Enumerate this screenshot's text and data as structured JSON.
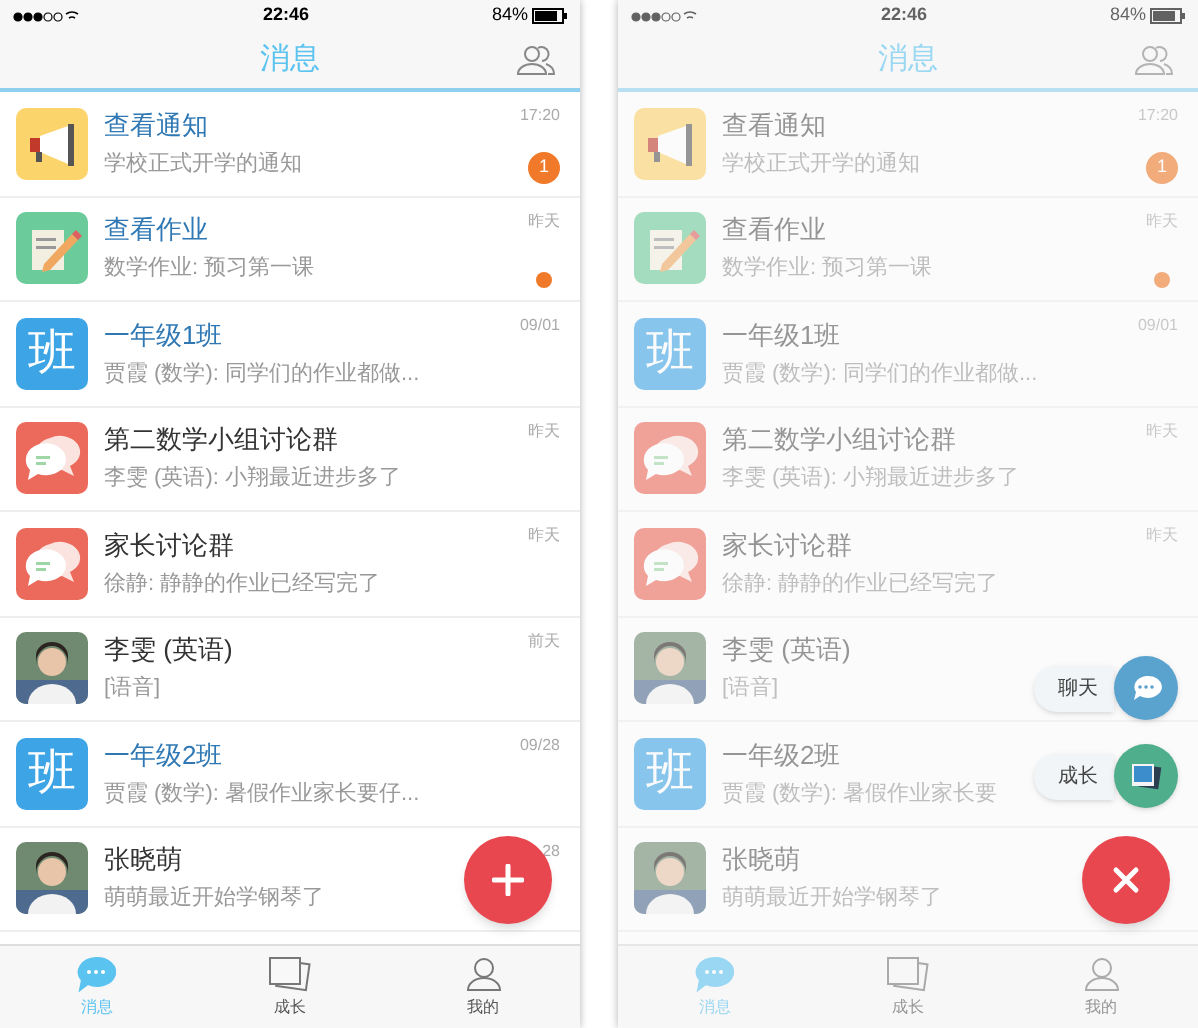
{
  "screens": [
    {
      "dimmed": false,
      "status_bar": {
        "time": "22:46",
        "battery": "84%"
      },
      "header": {
        "title": "消息"
      },
      "conversations": [
        {
          "avatar": {
            "kind": "megaphone"
          },
          "title": "查看通知",
          "color": "#2f78b4",
          "preview": "学校正式开学的通知",
          "time": "17:20",
          "badge": {
            "kind": "count",
            "text": "1"
          }
        },
        {
          "avatar": {
            "kind": "homework"
          },
          "title": "查看作业",
          "color": "#2f78b4",
          "preview": "数学作业: 预习第一课",
          "time": "昨天",
          "badge": {
            "kind": "dot"
          }
        },
        {
          "avatar": {
            "kind": "class",
            "text": "班"
          },
          "title": "一年级1班",
          "color": "#2f78b4",
          "preview": "贾霞 (数学): 同学们的作业都做...",
          "time": "09/01"
        },
        {
          "avatar": {
            "kind": "group"
          },
          "title": "第二数学小组讨论群",
          "color": "#333333",
          "preview": "李雯 (英语): 小翔最近进步多了",
          "time": "昨天"
        },
        {
          "avatar": {
            "kind": "group"
          },
          "title": "家长讨论群",
          "color": "#333333",
          "preview": "徐静: 静静的作业已经写完了",
          "time": "昨天"
        },
        {
          "title": "李雯 (英语)",
          "color": "#333333",
          "preview": "[语音]",
          "time": "前天"
        },
        {
          "avatar": {
            "kind": "class",
            "text": "班"
          },
          "title": "一年级2班",
          "color": "#2f78b4",
          "preview": "贾霞 (数学): 暑假作业家长要仔...",
          "time": "09/28"
        },
        {
          "title": "张晓萌",
          "color": "#333333",
          "preview": "萌萌最近开始学钢琴了",
          "time": "28"
        }
      ],
      "tabs": [
        {
          "label": "消息",
          "kind": "chat",
          "selected": true
        },
        {
          "label": "成长",
          "kind": "photos",
          "selected": false
        },
        {
          "label": "我的",
          "kind": "person",
          "selected": false
        }
      ],
      "fab": {
        "expanded": false
      }
    },
    {
      "dimmed": true,
      "status_bar": {
        "time": "22:46",
        "battery": "84%"
      },
      "header": {
        "title": "消息"
      },
      "conversations": [
        {
          "avatar": {
            "kind": "megaphone"
          },
          "title": "查看通知",
          "preview": "学校正式开学的通知",
          "time": "17:20",
          "badge": {
            "kind": "count",
            "text": "1"
          }
        },
        {
          "avatar": {
            "kind": "homework"
          },
          "title": "查看作业",
          "preview": "数学作业: 预习第一课",
          "time": "昨天",
          "badge": {
            "kind": "dot"
          }
        },
        {
          "avatar": {
            "kind": "class",
            "text": "班"
          },
          "title": "一年级1班",
          "preview": "贾霞 (数学): 同学们的作业都做...",
          "time": "09/01"
        },
        {
          "avatar": {
            "kind": "group"
          },
          "title": "第二数学小组讨论群",
          "preview": "李雯 (英语): 小翔最近进步多了",
          "time": "昨天"
        },
        {
          "avatar": {
            "kind": "group"
          },
          "title": "家长讨论群",
          "preview": "徐静: 静静的作业已经写完了",
          "time": "昨天"
        },
        {
          "title": "李雯 (英语)",
          "preview": "[语音]"
        },
        {
          "avatar": {
            "kind": "class",
            "text": "班"
          },
          "title": "一年级2班",
          "preview": "贾霞 (数学): 暑假作业家长要"
        },
        {
          "title": "张晓萌",
          "preview": "萌萌最近开始学钢琴了"
        }
      ],
      "tabs": [
        {
          "label": "消息",
          "kind": "chat",
          "selected": true
        },
        {
          "label": "成长",
          "kind": "photos",
          "selected": false
        },
        {
          "label": "我的",
          "kind": "person",
          "selected": false
        }
      ],
      "fab": {
        "expanded": true,
        "menu": [
          {
            "label": "聊天",
            "kind": "chat"
          },
          {
            "label": "成长",
            "kind": "photos"
          }
        ]
      }
    }
  ]
}
